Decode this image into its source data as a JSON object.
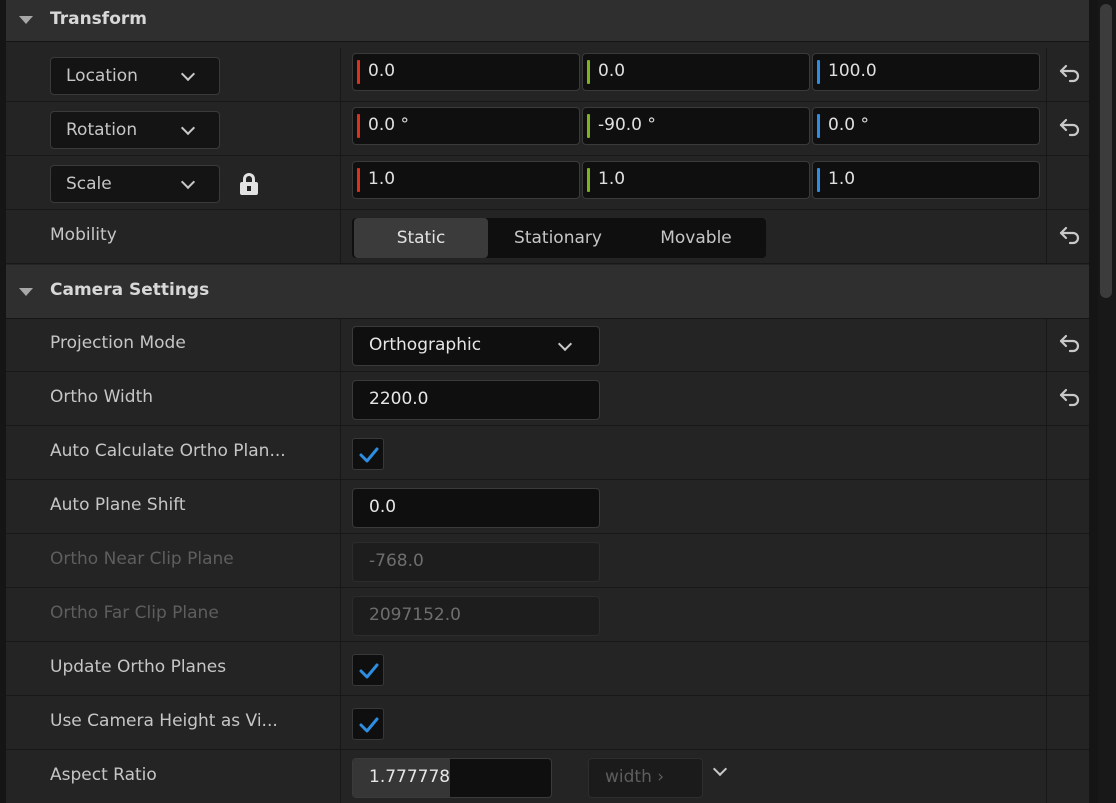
{
  "transform": {
    "title": "Transform",
    "location": {
      "label": "Location",
      "x": "0.0",
      "y": "0.0",
      "z": "100.0"
    },
    "rotation": {
      "label": "Rotation",
      "x": "0.0 °",
      "y": "-90.0 °",
      "z": "0.0 °"
    },
    "scale": {
      "label": "Scale",
      "x": "1.0",
      "y": "1.0",
      "z": "1.0"
    },
    "mobility": {
      "label": "Mobility",
      "options": [
        "Static",
        "Stationary",
        "Movable"
      ],
      "selected": "Static"
    }
  },
  "camera": {
    "title": "Camera Settings",
    "projection_mode": {
      "label": "Projection Mode",
      "value": "Orthographic"
    },
    "ortho_width": {
      "label": "Ortho Width",
      "value": "2200.0"
    },
    "auto_calc": {
      "label": "Auto Calculate Ortho Plan...",
      "checked": true
    },
    "auto_plane_shift": {
      "label": "Auto Plane Shift",
      "value": "0.0"
    },
    "near_clip": {
      "label": "Ortho Near Clip Plane",
      "value": "-768.0"
    },
    "far_clip": {
      "label": "Ortho Far Clip Plane",
      "value": "2097152.0"
    },
    "update_planes": {
      "label": "Update Ortho Planes",
      "checked": true
    },
    "use_height": {
      "label": "Use Camera Height as Vi...",
      "checked": true
    },
    "aspect_ratio": {
      "label": "Aspect Ratio",
      "value": "1.777778",
      "fill_fraction": 0.49,
      "unit": "width ›"
    }
  },
  "colors": {
    "axis_x": "#d9331f",
    "axis_y": "#7fb31d",
    "axis_z": "#2d8de0",
    "check": "#2d8de0"
  },
  "icons": {
    "collapse": "triangle-down-icon",
    "reset": "reset-arrow-icon",
    "lock": "lock-icon",
    "dropdown": "chevron-down-icon",
    "check": "checkmark-icon"
  }
}
